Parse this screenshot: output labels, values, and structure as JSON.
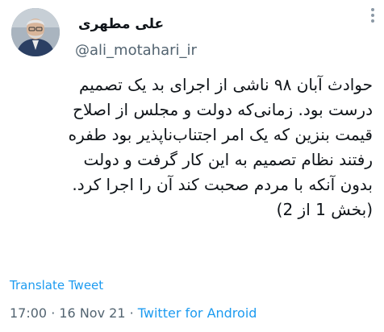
{
  "user": {
    "display_name": "علی مطهری",
    "handle": "@ali_motahari_ir"
  },
  "tweet": {
    "lines": [
      "حوادث آبان ۹۸ ناشی از اجرای بد یک تصمیم",
      "درست بود. زمانی‌که دولت و مجلس از اصلاح",
      "قیمت بنزین که یک امر اجتناب‌ناپذیر بود طفره",
      "رفتند نظام تصمیم به این کار گرفت و دولت",
      "بدون آنکه با مردم صحبت کند آن را اجرا کرد.",
      "(بخش 1 از 2)"
    ]
  },
  "translate_label": "Translate Tweet",
  "meta": {
    "time": "17:00",
    "separator": " · ",
    "date": "16 Nov 21",
    "source": "Twitter for Android"
  },
  "icons": {
    "more": "more-vertical-icon",
    "avatar": "avatar"
  },
  "colors": {
    "link": "#1d9bf0",
    "text": "#0f1419",
    "secondary": "#536471"
  }
}
